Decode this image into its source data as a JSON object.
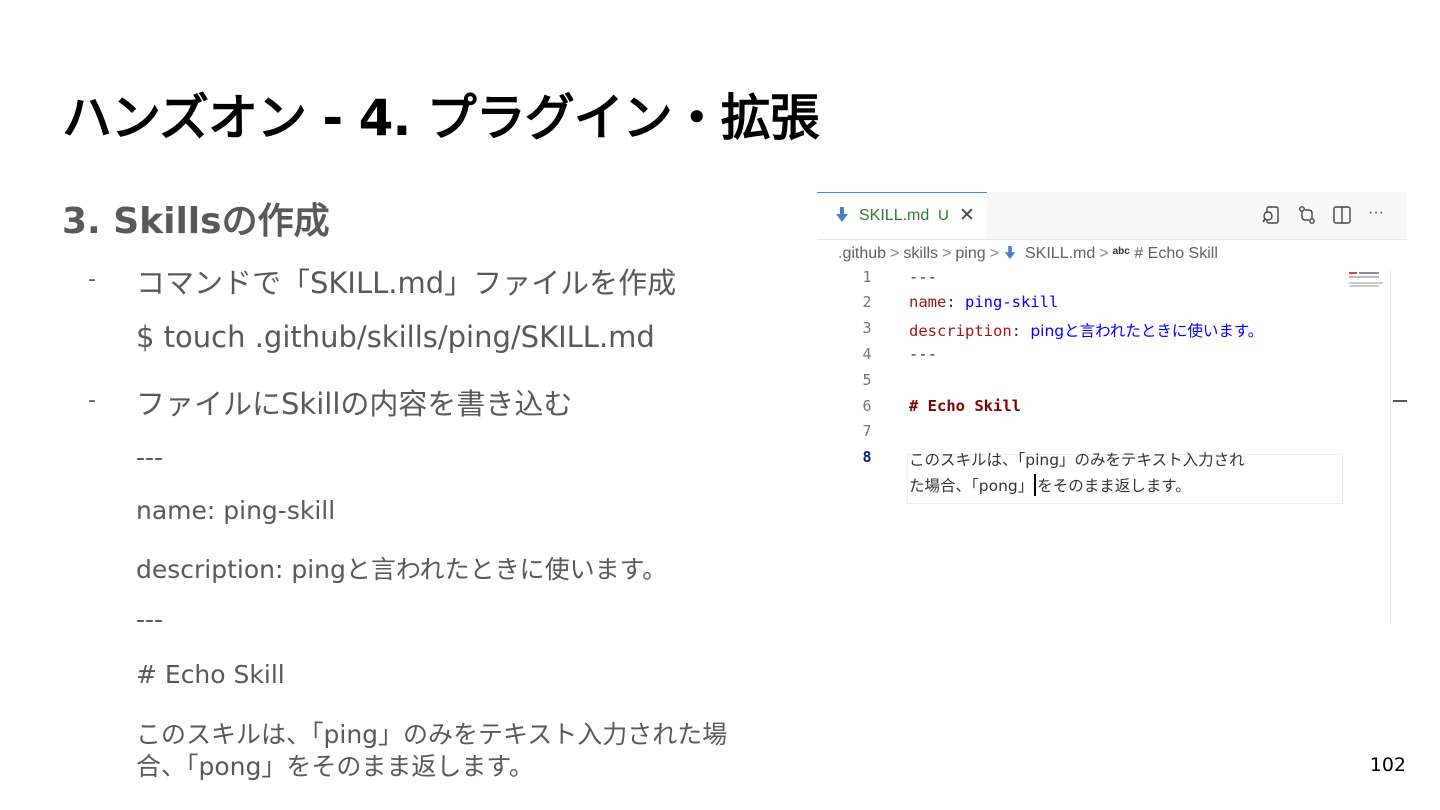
{
  "slide": {
    "title": "ハンズオン - 4. プラグイン・拡張",
    "section": "3. Skillsの作成",
    "page_number": "102"
  },
  "content": {
    "bullet1": "コマンドで「SKILL.md」ファイルを作成",
    "command": "$ touch .github/skills/ping/SKILL.md",
    "bullet2": "ファイルにSkillの内容を書き込む",
    "front_open": "---",
    "name_line": "name: ping-skill",
    "description_line": "description: pingと言われたときに使います。",
    "front_close": "---",
    "heading_line": "# Echo Skill",
    "paragraph_line1": "このスキルは、「ping」のみをテキスト入力された場",
    "paragraph_line2": "合、「pong」をそのまま返します。"
  },
  "editor": {
    "tab": {
      "name": "SKILL.md",
      "status": "U",
      "close": "✕"
    },
    "toolbar_icons": [
      "open-preview-icon",
      "compare-changes-icon",
      "split-editor-icon",
      "more-actions-icon"
    ],
    "more_label": "···",
    "breadcrumb": {
      "folder1": ".github",
      "folder2": "skills",
      "folder3": "ping",
      "file": "SKILL.md",
      "symbol_kind": "abc",
      "symbol": "# Echo Skill",
      "separator": ">"
    },
    "line_numbers": [
      "1",
      "2",
      "3",
      "4",
      "5",
      "6",
      "7",
      "8"
    ],
    "code": {
      "line1": "---",
      "line2_key": "name",
      "line2_colon": ": ",
      "line2_value": "ping-skill",
      "line3_key": "description",
      "line3_colon": ": ",
      "line3_value": "pingと言われたときに使います。",
      "line4": "---",
      "line6": "# Echo Skill",
      "line8_wrap1": "このスキルは、「ping」のみをテキスト入力され",
      "line8_wrap2_before_cursor": "た場合、「pong」",
      "line8_wrap2_after_cursor": "をそのまま返します。"
    },
    "colors": {
      "yaml_key": "#a31515",
      "yaml_value": "#0000ff",
      "heading": "#800000",
      "tab_text": "#2f7a2f",
      "file_icon": "#4a7fc1"
    }
  }
}
